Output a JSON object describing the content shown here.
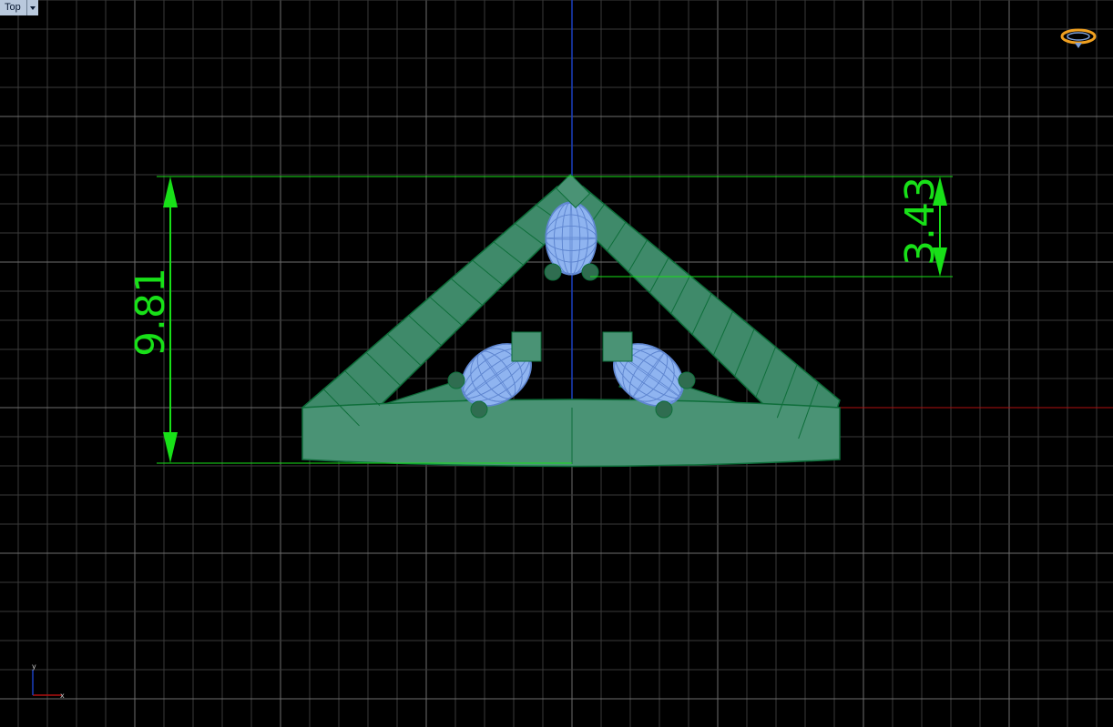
{
  "viewport": {
    "view_name": "Top",
    "dimensions": [
      {
        "label": "9.81",
        "orientation": "vertical"
      },
      {
        "label": "3.43",
        "orientation": "vertical"
      }
    ],
    "axis_icon": {
      "x_label": "x",
      "y_label": "y"
    }
  },
  "colors": {
    "background": "#000000",
    "grid_minor": "#3a3a3a",
    "grid_major": "#6e6e6e",
    "x_axis": "#b01010",
    "y_axis": "#1a3fc0",
    "dimension": "#18e018",
    "model_fill": "#3f8a6a",
    "model_edge": "#0e6e3a",
    "gem": "#8fb4f0"
  },
  "icons": {
    "top_right": "gumball-orbit-icon",
    "bottom_left": "world-axes-icon"
  }
}
